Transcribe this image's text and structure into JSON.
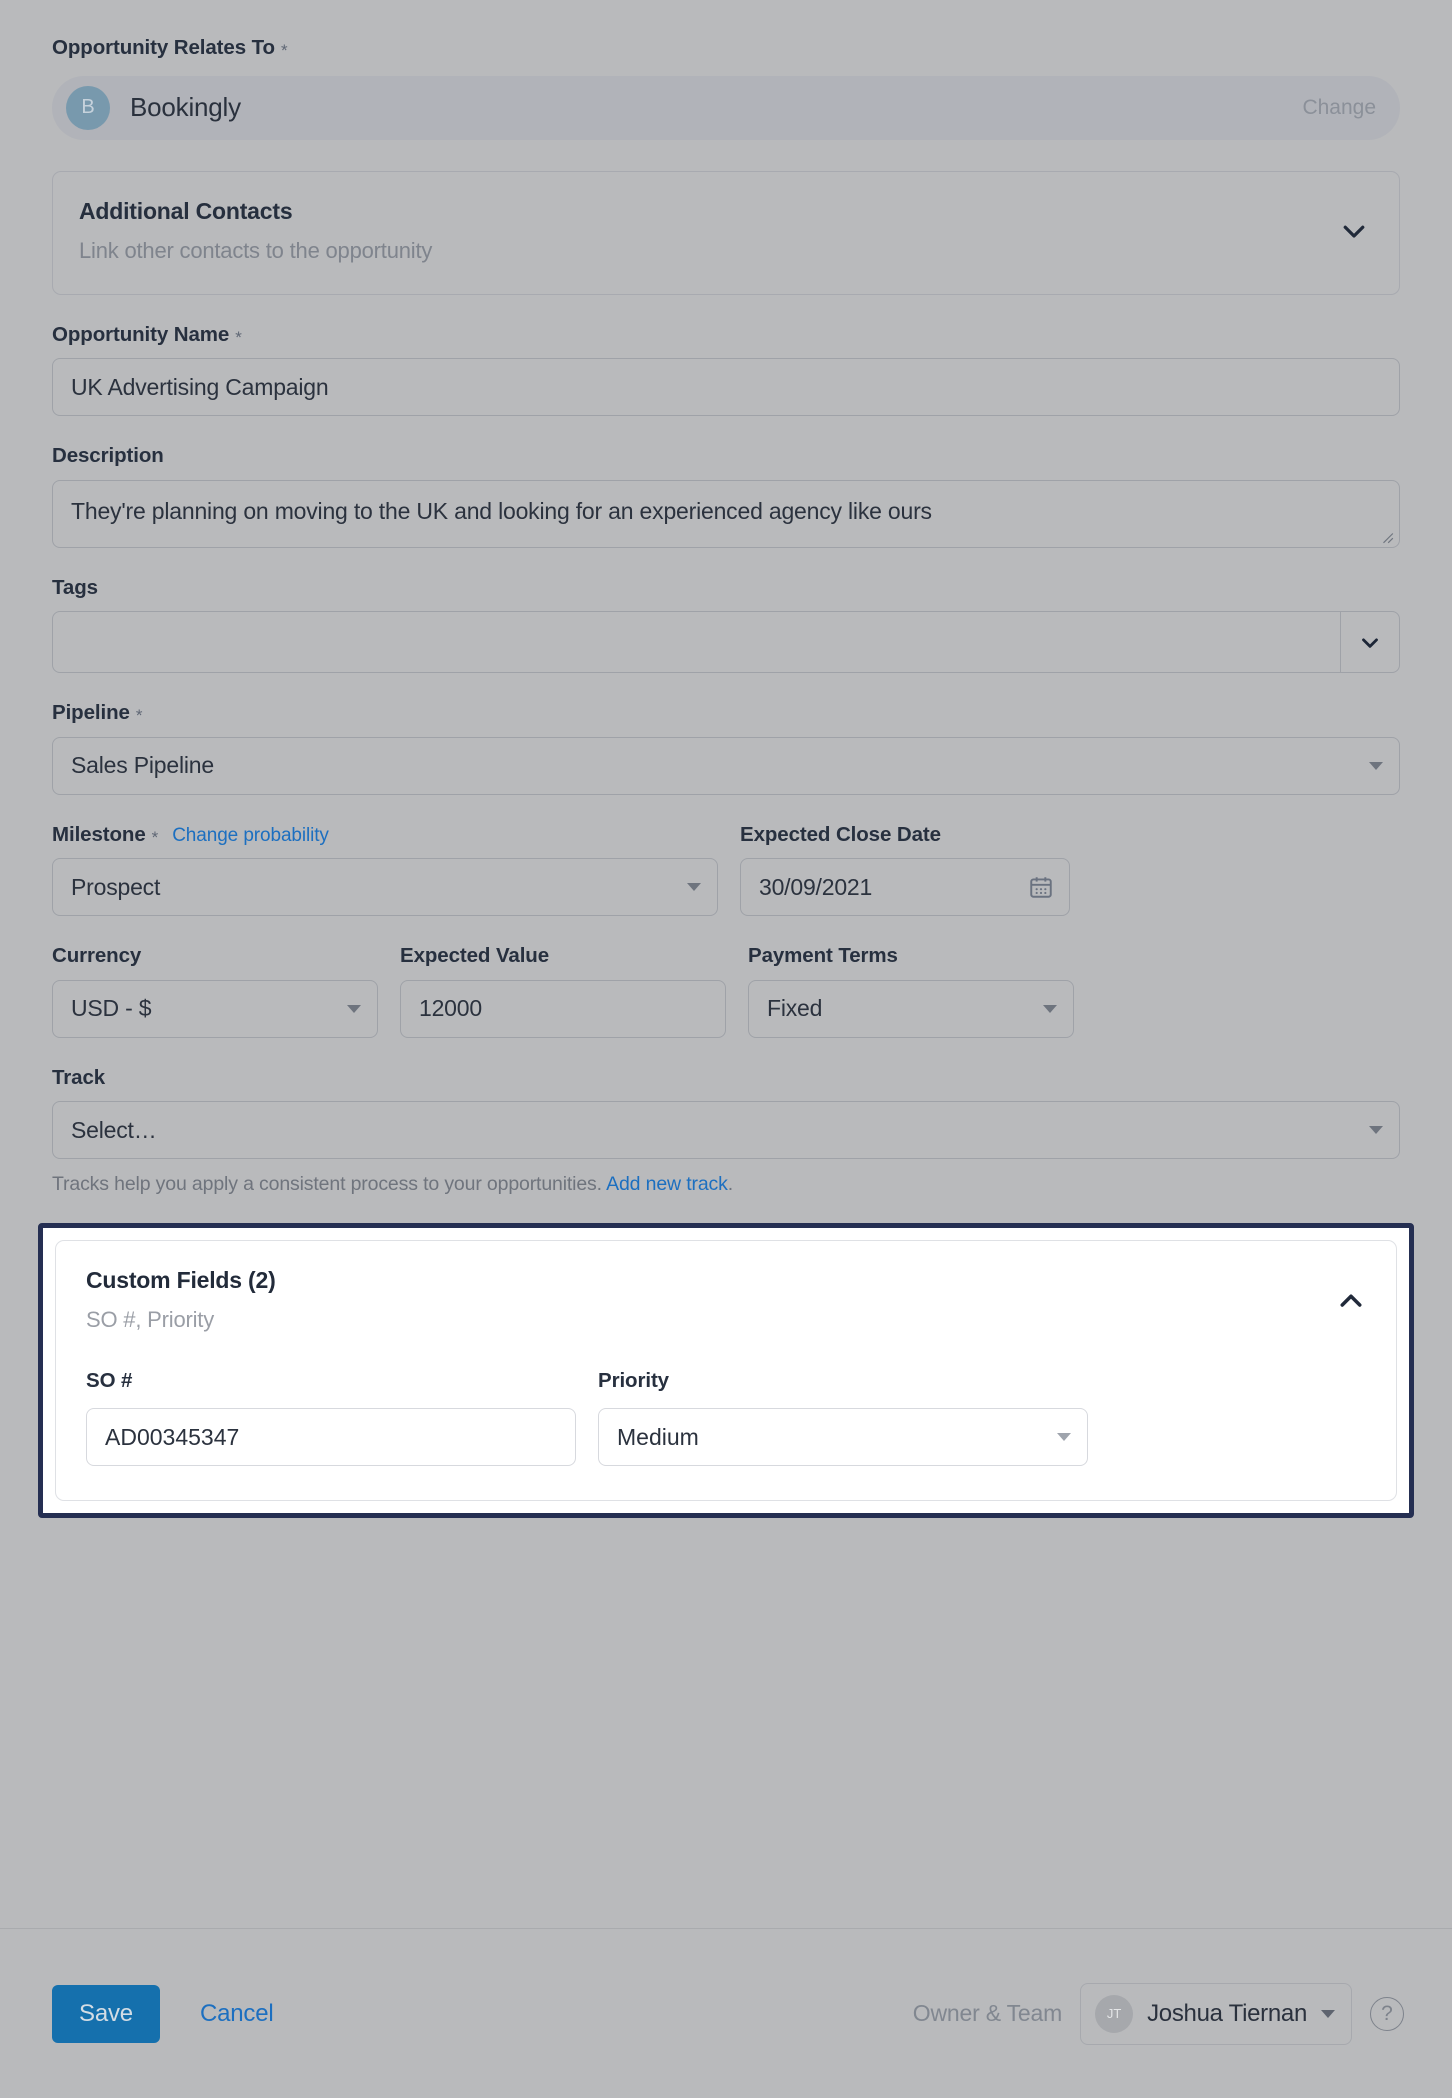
{
  "relates_to": {
    "label": "Opportunity Relates To",
    "required_mark": "*",
    "avatar_initial": "B",
    "account_name": "Bookingly",
    "change_label": "Change"
  },
  "additional_contacts": {
    "title": "Additional Contacts",
    "subtitle": "Link other contacts to the opportunity",
    "toggle_icon": "chevron-down-icon"
  },
  "opportunity_name": {
    "label": "Opportunity Name",
    "required_mark": "*",
    "value": "UK Advertising Campaign",
    "placeholder": ""
  },
  "description": {
    "label": "Description",
    "value": "They're planning on moving to the UK and looking for an experienced agency like ours",
    "placeholder": ""
  },
  "tags": {
    "label": "Tags",
    "value": "",
    "placeholder": "",
    "toggle_icon": "chevron-down-icon"
  },
  "pipeline": {
    "label": "Pipeline",
    "required_mark": "*",
    "value": "Sales Pipeline"
  },
  "milestone": {
    "label": "Milestone",
    "required_mark": "*",
    "link_label": "Change probability",
    "value": "Prospect"
  },
  "expected_close_date": {
    "label": "Expected Close Date",
    "value": "30/09/2021",
    "icon": "calendar-icon"
  },
  "currency": {
    "label": "Currency",
    "value": "USD - $"
  },
  "expected_value": {
    "label": "Expected Value",
    "value": "12000",
    "placeholder": ""
  },
  "payment_terms": {
    "label": "Payment Terms",
    "value": "Fixed"
  },
  "track": {
    "label": "Track",
    "value": "Select…",
    "helper_prefix": "Tracks help you apply a consistent process to your opportunities.",
    "helper_link": "Add new track",
    "helper_suffix": "."
  },
  "custom_fields": {
    "title": "Custom Fields (2)",
    "subtitle": "SO #, Priority",
    "toggle_icon": "chevron-up-icon",
    "highlight_color": "#252f52",
    "fields": [
      {
        "label": "SO #",
        "value": "AD00345347",
        "type": "text"
      },
      {
        "label": "Priority",
        "value": "Medium",
        "type": "select"
      }
    ]
  },
  "footer": {
    "save_label": "Save",
    "cancel_label": "Cancel",
    "owner_team_label": "Owner & Team",
    "owner_initials": "JT",
    "owner_name": "Joshua Tiernan",
    "help_glyph": "?",
    "save_color": "#1570ad",
    "link_color": "#1c6fc0"
  }
}
